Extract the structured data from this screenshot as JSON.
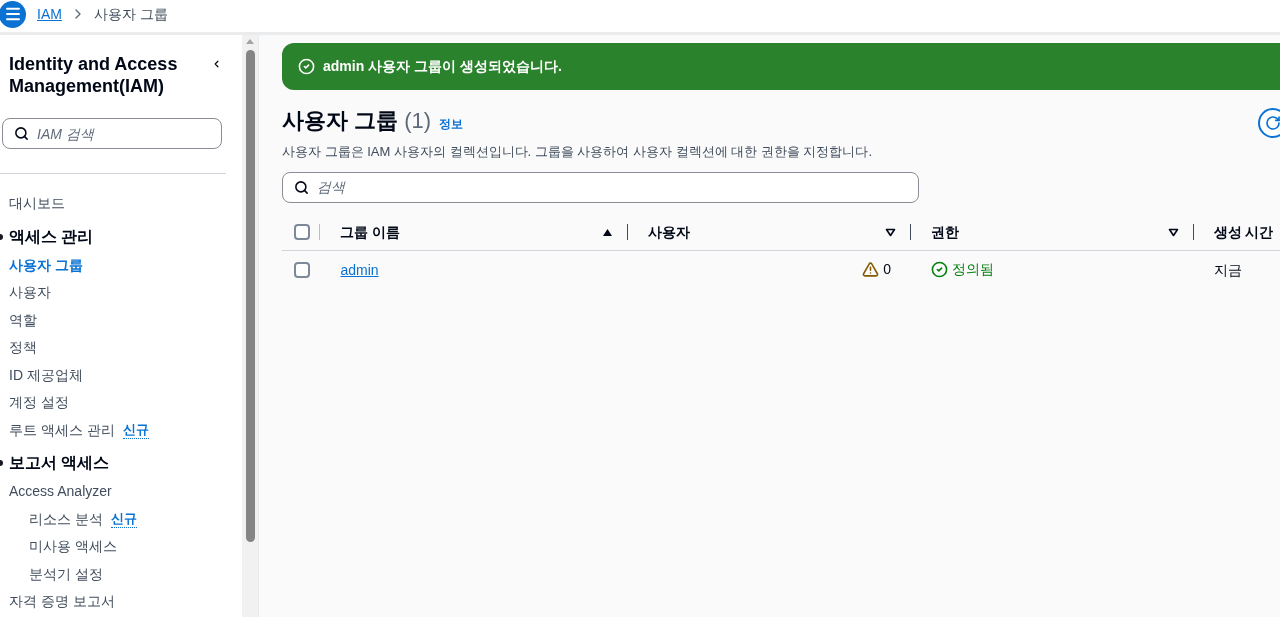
{
  "breadcrumb": [
    {
      "label": "IAM",
      "kind": "link"
    },
    {
      "label": "사용자 그룹",
      "kind": "current"
    }
  ],
  "sidebar": {
    "title": "Identity and Access Management(IAM)",
    "search": {
      "placeholder": "IAM 검색"
    },
    "items": [
      {
        "kind": "link",
        "label": "대시보드",
        "selected": false
      },
      {
        "kind": "section",
        "label": "액세스 관리",
        "expanded": true,
        "children": [
          {
            "kind": "link",
            "label": "사용자 그룹",
            "selected": true
          },
          {
            "kind": "link",
            "label": "사용자",
            "selected": false
          },
          {
            "kind": "link",
            "label": "역할",
            "selected": false
          },
          {
            "kind": "link",
            "label": "정책",
            "selected": false
          },
          {
            "kind": "link",
            "label": "ID 제공업체",
            "selected": false
          },
          {
            "kind": "link",
            "label": "계정 설정",
            "selected": false
          },
          {
            "kind": "link",
            "label": "루트 액세스 관리",
            "selected": false,
            "badge": "신규"
          }
        ]
      },
      {
        "kind": "section",
        "label": "보고서 액세스",
        "expanded": true,
        "children": [
          {
            "kind": "link",
            "label": "Access Analyzer",
            "selected": false,
            "children": [
              {
                "kind": "link",
                "label": "리소스 분석",
                "selected": false,
                "badge": "신규"
              },
              {
                "kind": "link",
                "label": "미사용 액세스",
                "selected": false
              },
              {
                "kind": "link",
                "label": "분석기 설정",
                "selected": false
              }
            ]
          },
          {
            "kind": "link",
            "label": "자격 증명 보고서",
            "selected": false
          }
        ]
      }
    ]
  },
  "flash": {
    "kind": "success",
    "message": "admin 사용자 그룹이 생성되었습니다."
  },
  "header": {
    "title": "사용자 그룹",
    "count": "(1)",
    "info": "정보",
    "description": "사용자 그룹은 IAM 사용자의 컬렉션입니다. 그룹을 사용하여 사용자 컬렉션에 대한 권한을 지정합니다."
  },
  "search": {
    "placeholder": "검색"
  },
  "table": {
    "select_all": {
      "checked": false
    },
    "columns": [
      {
        "label": "그룹 이름",
        "sorted": true
      },
      {
        "label": "사용자",
        "sorted": false
      },
      {
        "label": "권한",
        "sorted": false
      },
      {
        "label": "생성 시간"
      }
    ],
    "rows": [
      {
        "checked": false,
        "name": "admin",
        "users": {
          "kind": "warning",
          "text": "0"
        },
        "permissions": {
          "kind": "success",
          "text": "정의됨"
        },
        "created": "지금"
      }
    ]
  }
}
